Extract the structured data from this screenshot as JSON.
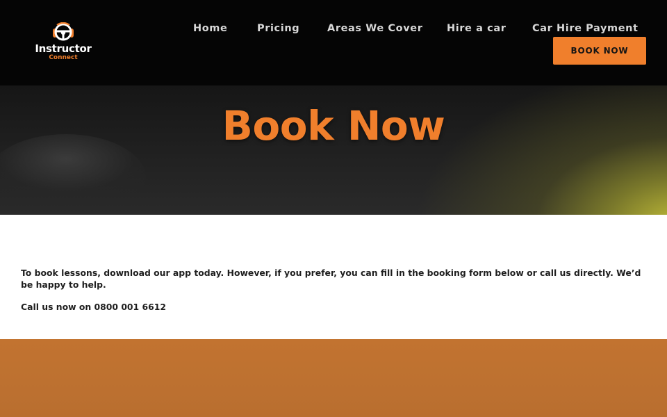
{
  "brand": {
    "name": "Instructor",
    "sub": "Connect",
    "accent_color": "#f07f2c",
    "icon": "steering-wheel-icon"
  },
  "nav": {
    "items": [
      {
        "label": "Home"
      },
      {
        "label": "Pricing"
      },
      {
        "label": "Areas We Cover"
      },
      {
        "label": "Hire a car"
      },
      {
        "label": "Car Hire Payment"
      }
    ],
    "cta_label": "BOOK NOW"
  },
  "hero": {
    "title": "Book Now"
  },
  "content": {
    "intro": "To book lessons, download our app today. However, if you prefer, you can fill in the booking form below or call us directly. We’d be happy to help.",
    "call": "Call us now on 0800 001 6612"
  },
  "colors": {
    "header_bg": "#050505",
    "accent": "#f07f2c",
    "footer_band": "#c27330"
  }
}
